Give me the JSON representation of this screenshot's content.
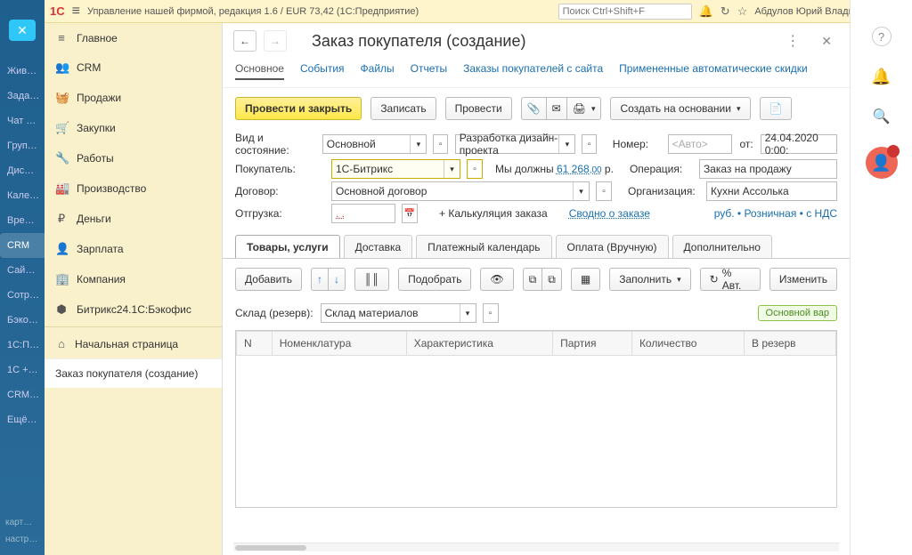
{
  "yellow_header": {
    "title": "Управление нашей фирмой, редакция 1.6 / EUR 73,42   (1С:Предприятие)",
    "search_placeholder": "Поиск Ctrl+Shift+F",
    "user": "Абдулов Юрий Владимирович"
  },
  "bitrix": {
    "items": [
      "Жив…",
      "Зада…",
      "Чат …",
      "Груп…",
      "Дис…",
      "Кале…",
      "Вре…",
      "CRM",
      "Сай…",
      "Сотр…",
      "Бэко…",
      "1С:П…",
      "1С +…",
      "CRM…",
      "Ещё…"
    ],
    "active_index": 7,
    "foot1": "карт…",
    "foot2": "настр…"
  },
  "leftmenu": {
    "items": [
      {
        "icon": "≡",
        "label": "Главное"
      },
      {
        "icon": "👥",
        "label": "CRM"
      },
      {
        "icon": "🧺",
        "label": "Продажи"
      },
      {
        "icon": "🛒",
        "label": "Закупки"
      },
      {
        "icon": "🔧",
        "label": "Работы"
      },
      {
        "icon": "🏭",
        "label": "Производство"
      },
      {
        "icon": "₽",
        "label": "Деньги"
      },
      {
        "icon": "👤",
        "label": "Зарплата"
      },
      {
        "icon": "🏢",
        "label": "Компания"
      },
      {
        "icon": "⬢",
        "label": "Битрикс24.1С:Бэкофис"
      }
    ],
    "home": "Начальная страница",
    "sub": "Заказ покупателя (создание)"
  },
  "page": {
    "title": "Заказ покупателя (создание)",
    "top_tabs": [
      "Основное",
      "События",
      "Файлы",
      "Отчеты",
      "Заказы покупателей с сайта",
      "Примененные автоматические скидки"
    ],
    "active_top_tab": 0
  },
  "toolbar": {
    "submit": "Провести и закрыть",
    "save": "Записать",
    "post": "Провести",
    "create_based": "Создать на основании"
  },
  "form": {
    "lbl_kind": "Вид и состояние:",
    "val_kind": "Основной",
    "val_state": "Разработка дизайн-проекта",
    "lbl_number": "Номер:",
    "ph_number": "<Авто>",
    "lbl_from": "от:",
    "val_date": "24.04.2020  0:00:",
    "lbl_customer": "Покупатель:",
    "val_customer": "1С-Битрикс",
    "debt_prefix": "Мы должны ",
    "debt_amount": "61 268",
    "debt_dec": ",00",
    "debt_suffix": " р.",
    "lbl_operation": "Операция:",
    "val_operation": "Заказ на продажу",
    "lbl_contract": "Договор:",
    "val_contract": "Основной договор",
    "lbl_org": "Организация:",
    "val_org": "Кухни Ассолька",
    "lbl_shipment": "Отгрузка:",
    "val_shipment": "   .   .    ",
    "lbl_calc": "+ Калькуляция заказа",
    "link_summary": "Сводно о заказе",
    "link_currency": "руб. • Розничная • с НДС"
  },
  "subtabs": {
    "items": [
      "Товары, услуги",
      "Доставка",
      "Платежный календарь",
      "Оплата (Вручную)",
      "Дополнительно"
    ],
    "active": 0
  },
  "subbar": {
    "add": "Добавить",
    "pick": "Подобрать",
    "fill": "Заполнить",
    "pct": "% Авт.",
    "change": "Изменить"
  },
  "warehouse": {
    "label": "Склад (резерв):",
    "value": "Склад материалов",
    "badge": "Основной вар"
  },
  "table_headers": [
    "N",
    "Номенклатура",
    "Характеристика",
    "Партия",
    "Количество",
    "В резерв"
  ]
}
